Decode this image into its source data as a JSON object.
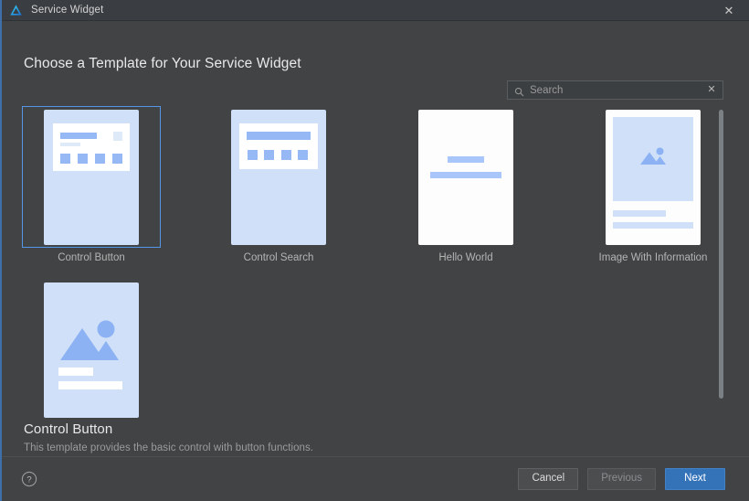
{
  "titlebar": {
    "icon": "app-logo-icon",
    "title": "Service Widget",
    "close_label": "✕"
  },
  "page": {
    "heading": "Choose a Template for Your Service Widget"
  },
  "search": {
    "icon": "search-icon",
    "placeholder": "Search",
    "value": "",
    "clear_label": "✕"
  },
  "templates": [
    {
      "label": "Control Button",
      "selected": true
    },
    {
      "label": "Control Search",
      "selected": false
    },
    {
      "label": "Hello World",
      "selected": false
    },
    {
      "label": "Image With Information",
      "selected": false
    }
  ],
  "preview": {
    "title": "Control Button",
    "description": "This template provides the basic control with button functions.",
    "image_icon": "picture-icon"
  },
  "footer": {
    "help_label": "?",
    "cancel_label": "Cancel",
    "previous_label": "Previous",
    "next_label": "Next"
  },
  "colors": {
    "window_bg": "#414345",
    "titlebar_bg": "#3a3d41",
    "accent": "#5596e6",
    "primary_button": "#3573b9",
    "thumb_blue": "#cfe0f8",
    "thumb_accent": "#96b9f5",
    "left_edge": "#3f6fa8"
  }
}
